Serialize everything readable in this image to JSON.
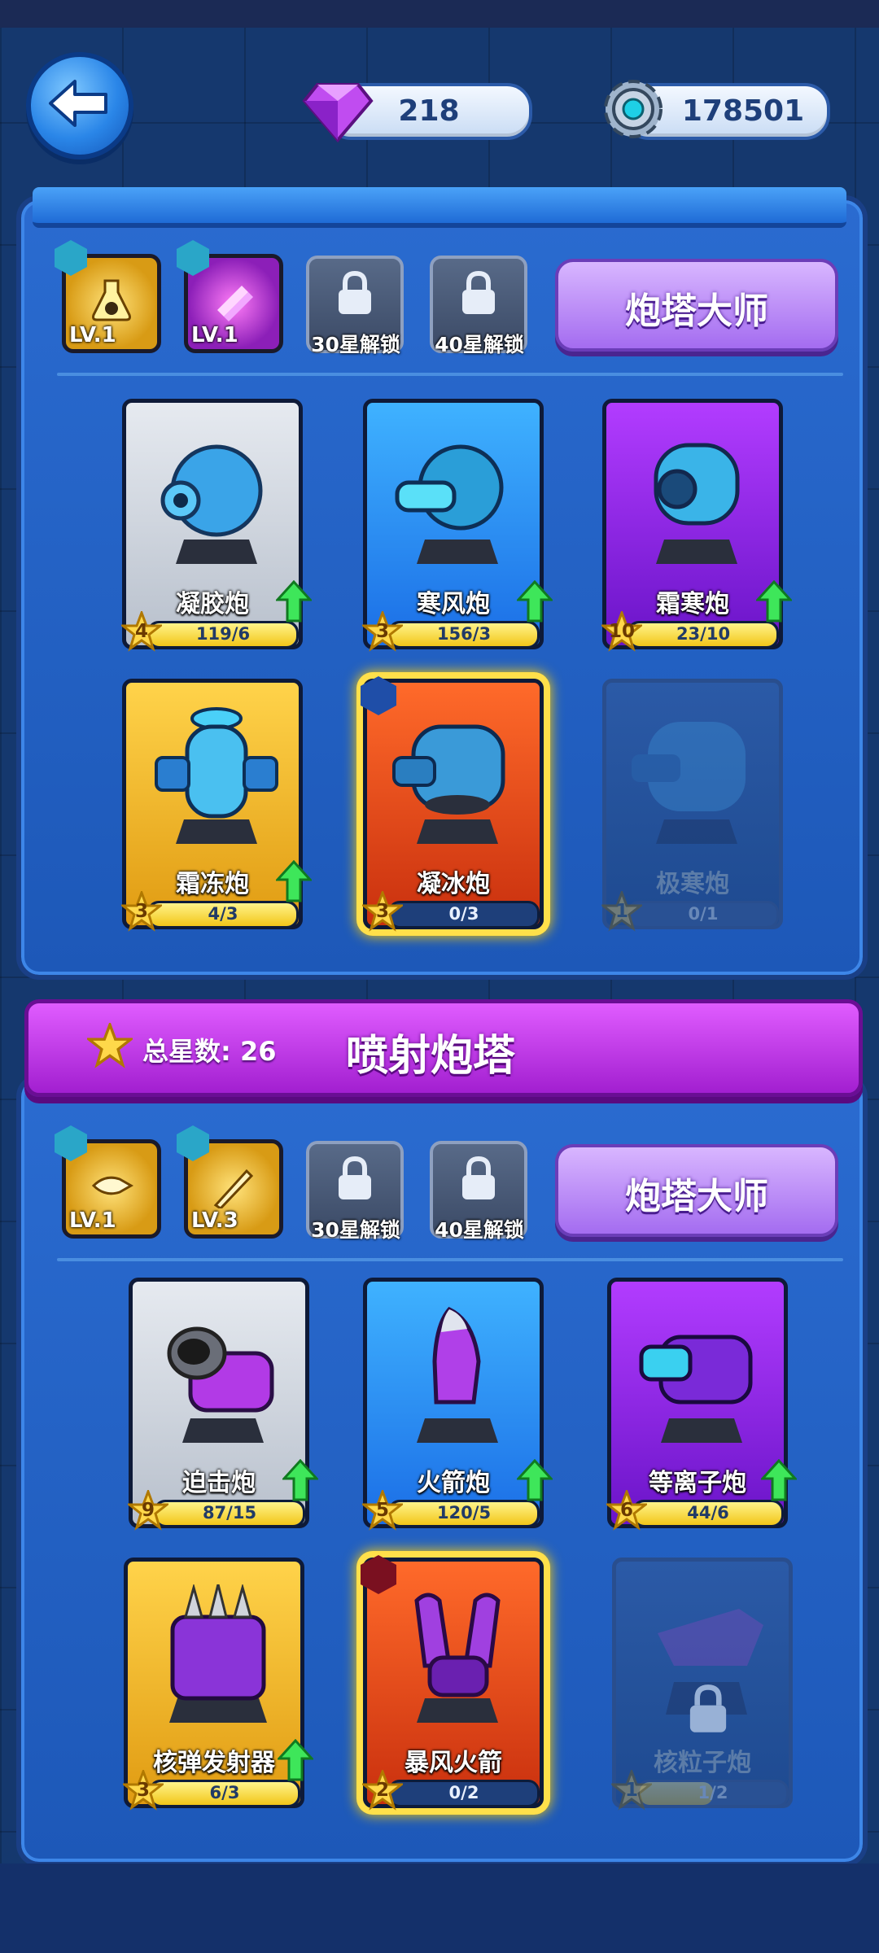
{
  "header": {
    "back_icon": "back-arrow-icon",
    "gems": "218",
    "gears": "178501",
    "gem_color": "#c04cf0",
    "gear_color": "#9fb4cc"
  },
  "section1": {
    "skills": [
      {
        "level": "LV.1",
        "icon": "poison-flask-icon"
      },
      {
        "level": "LV.1",
        "icon": "missile-volley-icon"
      }
    ],
    "locked": [
      "30星解锁",
      "40星解锁"
    ],
    "master_label": "炮塔大师",
    "cards": [
      {
        "name": "凝胶炮",
        "stars": "4",
        "progress": "119/6",
        "color": "white",
        "upgrade": true,
        "fill": 1
      },
      {
        "name": "寒风炮",
        "stars": "3",
        "progress": "156/3",
        "color": "blue",
        "upgrade": true,
        "fill": 1
      },
      {
        "name": "霜寒炮",
        "stars": "10",
        "progress": "23/10",
        "color": "purple",
        "upgrade": true,
        "fill": 1
      },
      {
        "name": "霜冻炮",
        "stars": "3",
        "progress": "4/3",
        "color": "gold",
        "upgrade": true,
        "fill": 1
      },
      {
        "name": "凝冰炮",
        "stars": "3",
        "progress": "0/3",
        "color": "red",
        "upgrade": false,
        "fill": 0,
        "selected": true
      },
      {
        "name": "极寒炮",
        "stars": "1",
        "progress": "0/1",
        "color": "dim",
        "upgrade": false,
        "fill": 0
      }
    ]
  },
  "section2": {
    "total_stars": "总星数: 26",
    "title": "喷射炮塔",
    "skills": [
      {
        "level": "LV.1",
        "icon": "bullet-icon"
      },
      {
        "level": "LV.3",
        "icon": "rocket-trail-icon"
      }
    ],
    "locked": [
      "30星解锁",
      "40星解锁"
    ],
    "master_label": "炮塔大师",
    "cards": [
      {
        "name": "迫击炮",
        "stars": "9",
        "progress": "87/15",
        "color": "white",
        "upgrade": true,
        "fill": 1
      },
      {
        "name": "火箭炮",
        "stars": "5",
        "progress": "120/5",
        "color": "blue",
        "upgrade": true,
        "fill": 1
      },
      {
        "name": "等离子炮",
        "stars": "6",
        "progress": "44/6",
        "color": "purple",
        "upgrade": true,
        "fill": 1
      },
      {
        "name": "核弹发射器",
        "stars": "3",
        "progress": "6/3",
        "color": "gold",
        "upgrade": true,
        "fill": 1
      },
      {
        "name": "暴风火箭",
        "stars": "2",
        "progress": "0/2",
        "color": "red",
        "upgrade": false,
        "fill": 0,
        "selected": true
      },
      {
        "name": "核粒子炮",
        "stars": "1",
        "progress": "1/2",
        "color": "dim",
        "upgrade": false,
        "fill": 0.5,
        "locked": true
      }
    ]
  }
}
